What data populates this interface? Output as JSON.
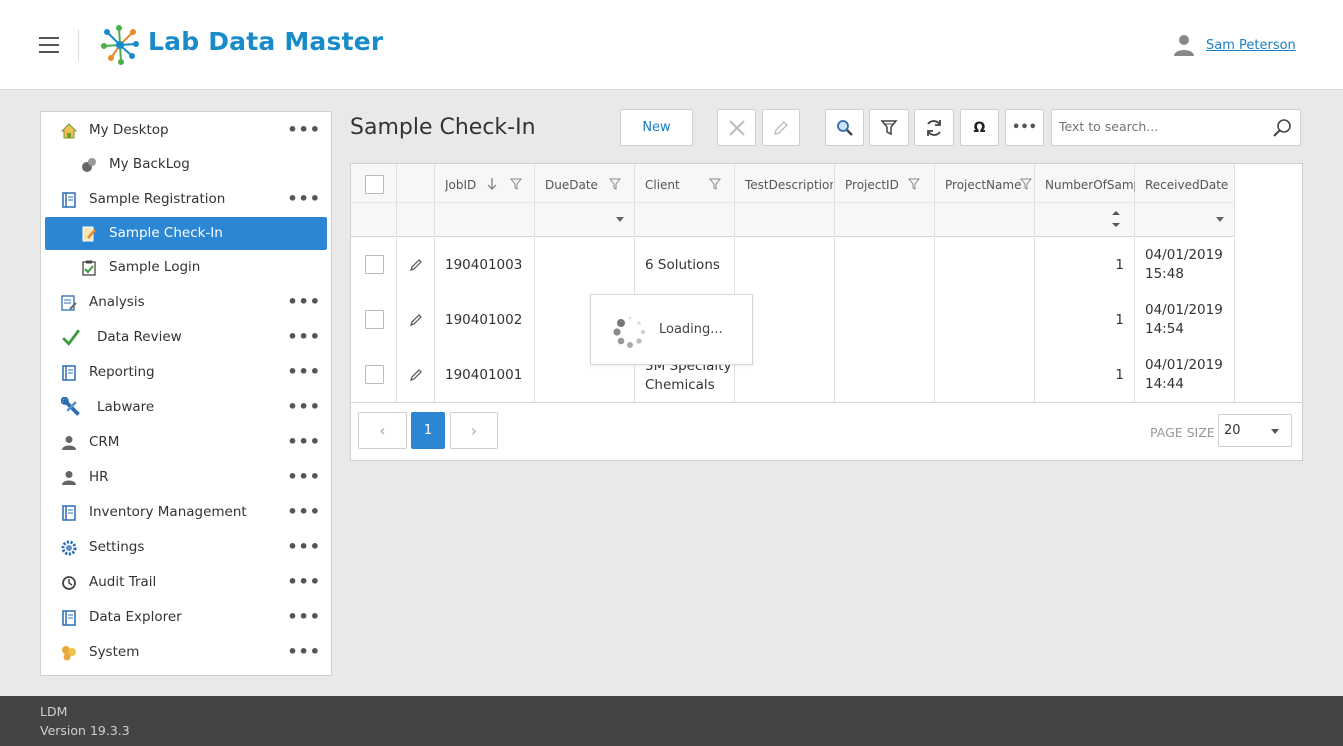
{
  "header": {
    "app_title": "Lab Data Master",
    "user_name": "Sam Peterson",
    "accent_color": "#1a8bc9"
  },
  "sidebar": {
    "items": [
      {
        "label": "My Desktop",
        "icon": "home-icon",
        "has_menu": true
      },
      {
        "label": "My BackLog",
        "icon": "backlog-icon",
        "sub": true
      },
      {
        "label": "Sample Registration",
        "icon": "book-icon",
        "has_menu": true
      },
      {
        "label": "Sample Check-In",
        "icon": "checkin-icon",
        "sub": true,
        "active": true
      },
      {
        "label": "Sample Login",
        "icon": "clipboard-check-icon",
        "sub": true
      },
      {
        "label": "Analysis",
        "icon": "analysis-icon",
        "has_menu": true
      },
      {
        "label": "Data Review",
        "icon": "checkmark-icon",
        "has_menu": true
      },
      {
        "label": "Reporting",
        "icon": "book-icon",
        "has_menu": true
      },
      {
        "label": "Labware",
        "icon": "wrench-icon",
        "has_menu": true
      },
      {
        "label": "CRM",
        "icon": "person-icon",
        "has_menu": true
      },
      {
        "label": "HR",
        "icon": "person-icon",
        "has_menu": true
      },
      {
        "label": "Inventory Management",
        "icon": "book-icon",
        "has_menu": true
      },
      {
        "label": "Settings",
        "icon": "gear-icon",
        "has_menu": true
      },
      {
        "label": "Audit Trail",
        "icon": "history-icon",
        "has_menu": true
      },
      {
        "label": "Data Explorer",
        "icon": "book-icon",
        "has_menu": true
      },
      {
        "label": "System",
        "icon": "system-icon",
        "has_menu": true
      }
    ],
    "more_label": "•••",
    "active_color": "#2b86d4"
  },
  "main": {
    "page_title": "Sample Check-In",
    "toolbar": {
      "new_label": "New",
      "more_label": "•••",
      "omega_label": "Ω"
    },
    "search": {
      "placeholder": "Text to search..."
    }
  },
  "grid": {
    "columns": [
      "JobID",
      "DueDate",
      "Client",
      "TestDescription",
      "ProjectID",
      "ProjectName",
      "NumberOfSampl",
      "ReceivedDate"
    ],
    "rows": [
      {
        "job_id": "190401003",
        "client": "6 Solutions",
        "client2": "",
        "num_samples": "1",
        "received_date": "04/01/2019",
        "received_time": "15:48"
      },
      {
        "job_id": "190401002",
        "client": "",
        "client2": "",
        "num_samples": "1",
        "received_date": "04/01/2019",
        "received_time": "14:54"
      },
      {
        "job_id": "190401001",
        "client": "3M Specialty",
        "client2": "Chemicals",
        "num_samples": "1",
        "received_date": "04/01/2019",
        "received_time": "14:44"
      }
    ],
    "pager": {
      "prev": "‹",
      "current_page": "1",
      "next": "›",
      "page_size_label": "PAGE SIZE",
      "page_size": "20"
    },
    "loading_text": "Loading..."
  },
  "footer": {
    "product": "LDM",
    "version": "Version 19.3.3"
  }
}
